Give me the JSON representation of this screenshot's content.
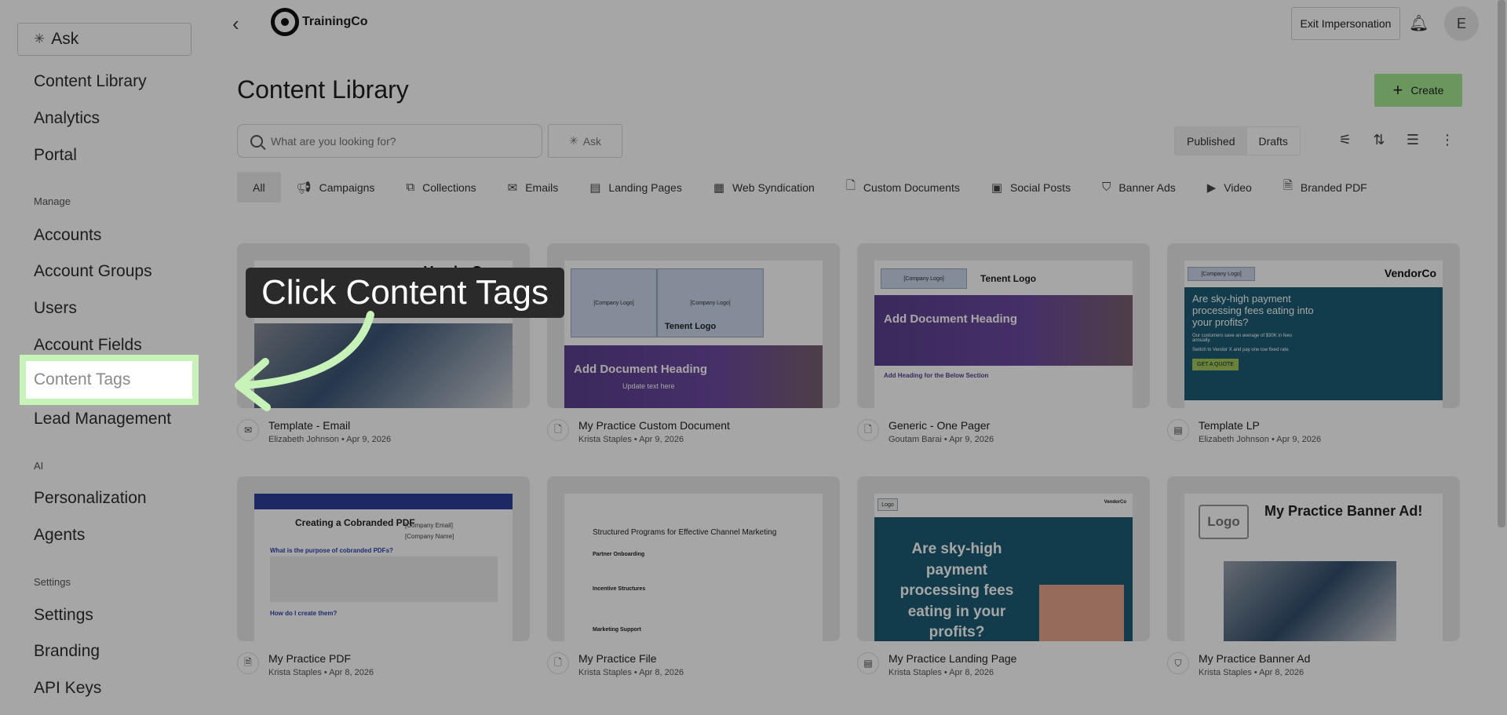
{
  "sidebar": {
    "ask": "Ask",
    "items_top": [
      "Content Library",
      "Analytics",
      "Portal"
    ],
    "manage_label": "Manage",
    "manage_items": [
      "Accounts",
      "Account Groups",
      "Users",
      "Account Fields",
      "Content Tags",
      "Lead Management"
    ],
    "ai_label": "AI",
    "ai_items": [
      "Personalization",
      "Agents"
    ],
    "settings_label": "Settings",
    "settings_items": [
      "Settings",
      "Branding",
      "API Keys"
    ]
  },
  "header": {
    "brand": "TrainingCo",
    "exit_impersonation": "Exit Impersonation",
    "avatar_initial": "E"
  },
  "page": {
    "title": "Content Library",
    "create_label": "Create",
    "search_placeholder": "What are you looking for?",
    "ask_label": "Ask",
    "published": "Published",
    "drafts": "Drafts"
  },
  "filters": [
    "All",
    "Campaigns",
    "Collections",
    "Emails",
    "Landing Pages",
    "Web Syndication",
    "Custom Documents",
    "Social Posts",
    "Banner Ads",
    "Video",
    "Branded PDF"
  ],
  "cards": [
    {
      "title": "Template - Email",
      "sub": "Elizabeth Johnson • Apr 9, 2026",
      "icon": "email-icon"
    },
    {
      "title": "My Practice Custom Document",
      "sub": "Krista Staples • Apr 9, 2026",
      "icon": "document-icon"
    },
    {
      "title": "Generic - One Pager",
      "sub": "Goutam Barai • Apr 9, 2026",
      "icon": "document-icon"
    },
    {
      "title": "Template LP",
      "sub": "Elizabeth Johnson • Apr 9, 2026",
      "icon": "landing-page-icon"
    },
    {
      "title": "My Practice PDF",
      "sub": "Krista Staples • Apr 8, 2026",
      "icon": "pdf-icon"
    },
    {
      "title": "My Practice File",
      "sub": "Krista Staples • Apr 8, 2026",
      "icon": "file-icon"
    },
    {
      "title": "My Practice Landing Page",
      "sub": "Krista Staples • Apr 8, 2026",
      "icon": "landing-page-icon"
    },
    {
      "title": "My Practice Banner Ad",
      "sub": "Krista Staples • Apr 8, 2026",
      "icon": "banner-ad-icon"
    }
  ],
  "thumbs": {
    "vendorco": "VendorCo",
    "company_logo": "[Company Logo]",
    "tenent_logo": "Tenent Logo",
    "add_doc_heading": "Add Document Heading",
    "update_text": "Update text here",
    "add_heading_below": "Add Heading for the Below Section",
    "lp_headline": "Are sky-high payment processing fees eating into your profits?",
    "lp_sub": "Our customers save an average of $30K in fees annually.",
    "lp_switch": "Switch to Vendor X and pay one low fixed rate.",
    "get_quote": "GET A QUOTE",
    "pdf_title": "Creating a Cobranded PDF",
    "pdf_company_email": "[Company Email]",
    "pdf_company_name": "[Company Name]",
    "pdf_q1": "What is the purpose of cobranded PDFs?",
    "pdf_q2": "How do I create them?",
    "file_title": "Structured Programs for Effective Channel Marketing",
    "file_h1": "Partner Onboarding",
    "file_h2": "Incentive Structures",
    "file_h3": "Marketing Support",
    "lp2_headline": "Are sky-high payment processing fees eating in your profits?",
    "logo": "Logo",
    "banner_title": "My Practice Banner Ad!"
  },
  "tutorial": {
    "callout": "Click Content Tags"
  },
  "colors": {
    "create_button": "#a5e893",
    "highlight": "#c7f3b9",
    "overlay": "rgba(0,0,0,0.35)"
  }
}
